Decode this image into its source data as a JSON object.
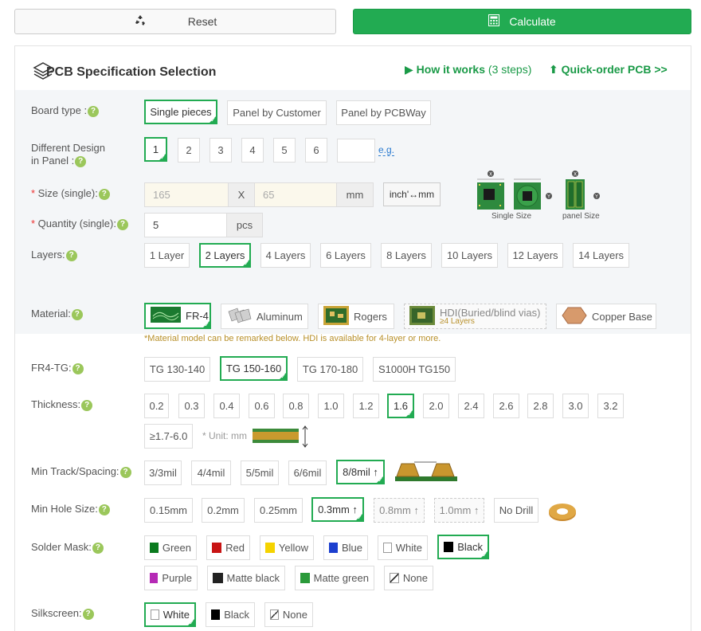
{
  "top": {
    "reset_label": "Reset",
    "calculate_label": "Calculate"
  },
  "header": {
    "title": "PCB Specification Selection",
    "how_label": "How it works",
    "how_steps": "(3 steps)",
    "quick_label": "Quick-order PCB >>"
  },
  "board_type": {
    "label": "Board type :",
    "options": [
      "Single pieces",
      "Panel by Customer",
      "Panel by PCBWay"
    ],
    "selected": "Single pieces"
  },
  "design": {
    "label_line1": "Different Design",
    "label_line2": "in Panel :",
    "options": [
      "1",
      "2",
      "3",
      "4",
      "5",
      "6"
    ],
    "selected": "1",
    "eg": "e.g."
  },
  "size": {
    "label": "Size (single):",
    "width_placeholder": "165",
    "height_placeholder": "65",
    "x": "X",
    "unit": "mm",
    "toggle": "inch'↔mm",
    "caption_single": "Single Size",
    "caption_panel": "panel Size"
  },
  "quantity": {
    "label": "Quantity (single):",
    "value": "5",
    "unit": "pcs"
  },
  "layers": {
    "label": "Layers:",
    "options": [
      "1 Layer",
      "2 Layers",
      "4 Layers",
      "6 Layers",
      "8 Layers",
      "10 Layers",
      "12 Layers",
      "14 Layers"
    ],
    "selected": "2 Layers"
  },
  "material": {
    "label": "Material:",
    "options": [
      "FR-4",
      "Aluminum",
      "Rogers",
      "HDI(Buried/blind vias)",
      "Copper Base"
    ],
    "hdi_sub": "≥4 Layers",
    "selected": "FR-4",
    "note": "*Material model can be remarked below. HDI is available for 4-layer or more."
  },
  "tg": {
    "label": "FR4-TG:",
    "options": [
      "TG 130-140",
      "TG 150-160",
      "TG 170-180",
      "S1000H TG150"
    ],
    "selected": "TG 150-160"
  },
  "thickness": {
    "label": "Thickness:",
    "options": [
      "0.2",
      "0.3",
      "0.4",
      "0.6",
      "0.8",
      "1.0",
      "1.2",
      "1.6",
      "2.0",
      "2.4",
      "2.6",
      "2.8",
      "3.0",
      "3.2"
    ],
    "extra": "≥1.7-6.0",
    "selected": "1.6",
    "unit_note": "* Unit: mm"
  },
  "track": {
    "label": "Min Track/Spacing:",
    "options": [
      "3/3mil",
      "4/4mil",
      "5/5mil",
      "6/6mil",
      "8/8mil ↑"
    ],
    "selected": "8/8mil ↑"
  },
  "hole": {
    "label": "Min Hole Size:",
    "options": [
      "0.15mm",
      "0.2mm",
      "0.25mm",
      "0.3mm ↑",
      "0.8mm ↑",
      "1.0mm ↑",
      "No Drill"
    ],
    "selected": "0.3mm ↑"
  },
  "mask": {
    "label": "Solder Mask:",
    "options": [
      {
        "name": "Green",
        "color": "#0a7a1e"
      },
      {
        "name": "Red",
        "color": "#c81414"
      },
      {
        "name": "Yellow",
        "color": "#f5d300"
      },
      {
        "name": "Blue",
        "color": "#1c3fcf"
      },
      {
        "name": "White",
        "color": "#ffffff"
      },
      {
        "name": "Black",
        "color": "#000000"
      },
      {
        "name": "Purple",
        "color": "#b52ab5"
      },
      {
        "name": "Matte black",
        "color": "#222222"
      },
      {
        "name": "Matte green",
        "color": "#2a9a3a"
      },
      {
        "name": "None",
        "color": "none"
      }
    ],
    "selected": "Black"
  },
  "silkscreen": {
    "label": "Silkscreen:",
    "options": [
      {
        "name": "White",
        "color": "#ffffff"
      },
      {
        "name": "Black",
        "color": "#000000"
      },
      {
        "name": "None",
        "color": "none"
      }
    ],
    "selected": "White"
  }
}
